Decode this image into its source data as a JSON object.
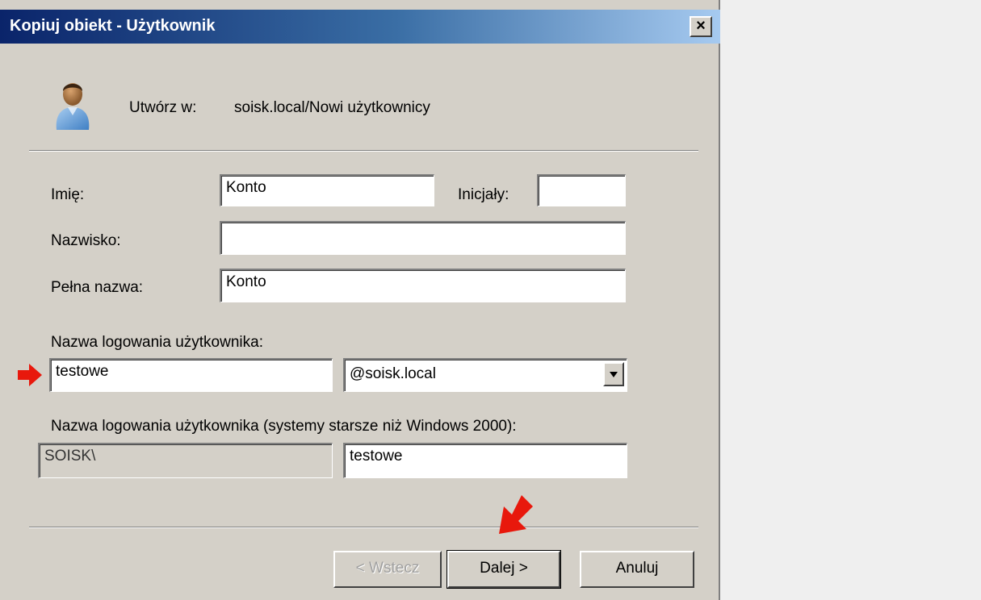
{
  "window": {
    "title": "Kopiuj obiekt - Użytkownik",
    "close_label": "×"
  },
  "header": {
    "create_in_label": "Utwórz w:",
    "create_in_path": "soisk.local/Nowi użytkownicy"
  },
  "form": {
    "first_name_label": "Imię:",
    "first_name_value": "Konto",
    "initials_label": "Inicjały:",
    "initials_value": "",
    "last_name_label": "Nazwisko:",
    "last_name_value": "",
    "full_name_label": "Pełna nazwa:",
    "full_name_value": "Konto",
    "logon_name_label": "Nazwa logowania użytkownika:",
    "logon_name_value": "testowe",
    "domain_selected": "@soisk.local",
    "legacy_logon_label": "Nazwa logowania użytkownika (systemy starsze niż Windows 2000):",
    "legacy_domain_value": "SOISK\\",
    "legacy_logon_value": "testowe"
  },
  "buttons": {
    "back_label": "< Wstecz",
    "next_label": "Dalej >",
    "cancel_label": "Anuluj"
  },
  "icons": {
    "user": "user-icon",
    "annotation_arrow_right": "arrow-right-icon",
    "annotation_arrow_down": "arrow-down-icon"
  },
  "colors": {
    "dialog_bg": "#d4d0c8",
    "title_gradient_start": "#0a246a",
    "title_gradient_end": "#a6caf0",
    "annotation_arrow": "#e8180c"
  }
}
